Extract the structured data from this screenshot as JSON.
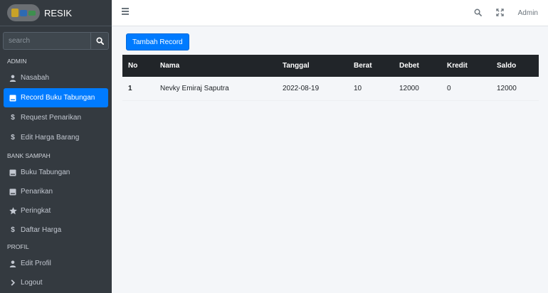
{
  "brand": {
    "name": "RESIK"
  },
  "search": {
    "placeholder": "search"
  },
  "sidebar": {
    "sections": [
      {
        "header": "ADMIN",
        "items": [
          {
            "label": "Nasabah",
            "icon": "user-icon"
          },
          {
            "label": "Record Buku Tabungan",
            "icon": "book-icon",
            "active": true
          },
          {
            "label": "Request Penarikan",
            "icon": "dollar-icon"
          },
          {
            "label": "Edit Harga Barang",
            "icon": "dollar-icon"
          }
        ]
      },
      {
        "header": "BANK SAMPAH",
        "items": [
          {
            "label": "Buku Tabungan",
            "icon": "book-icon"
          },
          {
            "label": "Penarikan",
            "icon": "book-icon"
          },
          {
            "label": "Peringkat",
            "icon": "star-icon"
          },
          {
            "label": "Daftar Harga",
            "icon": "dollar-icon"
          }
        ]
      },
      {
        "header": "PROFIL",
        "items": [
          {
            "label": "Edit Profil",
            "icon": "user-icon"
          },
          {
            "label": "Logout",
            "icon": "chevron-right-icon"
          }
        ]
      }
    ]
  },
  "topbar": {
    "user": "Admin"
  },
  "main": {
    "add_button": "Tambah Record",
    "table": {
      "columns": [
        "No",
        "Nama",
        "Tanggal",
        "Berat",
        "Debet",
        "Kredit",
        "Saldo"
      ],
      "rows": [
        [
          "1",
          "Nevky Emiraj Saputra",
          "2022-08-19",
          "10",
          "12000",
          "0",
          "12000"
        ]
      ]
    }
  },
  "colors": {
    "sidebar": "#343a40",
    "accent": "#007bff",
    "table_header": "#212529"
  }
}
